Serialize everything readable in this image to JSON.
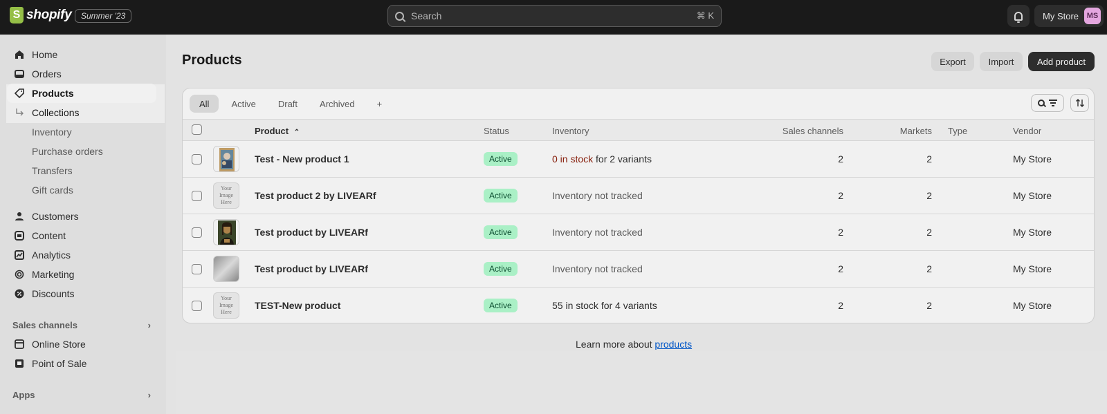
{
  "topbar": {
    "logo_text": "shopify",
    "edition": "Summer '23",
    "search_placeholder": "Search",
    "search_shortcut": "⌘ K",
    "store_name": "My Store",
    "avatar_initials": "MS"
  },
  "sidebar": {
    "items": [
      {
        "label": "Home",
        "icon": "home-icon"
      },
      {
        "label": "Orders",
        "icon": "inbox-icon"
      },
      {
        "label": "Products",
        "icon": "tag-icon"
      },
      {
        "label": "Collections",
        "icon": "sub-arrow-icon"
      },
      {
        "label": "Inventory"
      },
      {
        "label": "Purchase orders"
      },
      {
        "label": "Transfers"
      },
      {
        "label": "Gift cards"
      },
      {
        "label": "Customers",
        "icon": "person-icon"
      },
      {
        "label": "Content",
        "icon": "content-icon"
      },
      {
        "label": "Analytics",
        "icon": "chart-icon"
      },
      {
        "label": "Marketing",
        "icon": "target-icon"
      },
      {
        "label": "Discounts",
        "icon": "discount-icon"
      }
    ],
    "sales_channels_title": "Sales channels",
    "channels": [
      {
        "label": "Online Store",
        "icon": "store-icon"
      },
      {
        "label": "Point of Sale",
        "icon": "pos-icon"
      }
    ],
    "apps_title": "Apps"
  },
  "main": {
    "title": "Products",
    "export_label": "Export",
    "import_label": "Import",
    "add_label": "Add product",
    "tabs": [
      "All",
      "Active",
      "Draft",
      "Archived",
      "+"
    ],
    "columns": [
      "Product",
      "Status",
      "Inventory",
      "Sales channels",
      "Markets",
      "Type",
      "Vendor"
    ],
    "rows": [
      {
        "name": "Test - New product 1",
        "status": "Active",
        "inv_highlight": "0 in stock",
        "inv_rest": " for 2 variants",
        "channels": "2",
        "markets": "2",
        "type": "",
        "vendor": "My Store",
        "thumb": "painting"
      },
      {
        "name": "Test product 2 by LIVEARf",
        "status": "Active",
        "inv_highlight": "",
        "inv_rest": "Inventory not tracked",
        "channels": "2",
        "markets": "2",
        "type": "",
        "vendor": "My Store",
        "thumb": "placeholder"
      },
      {
        "name": "Test product by LIVEARf",
        "status": "Active",
        "inv_highlight": "",
        "inv_rest": "Inventory not tracked",
        "channels": "2",
        "markets": "2",
        "type": "",
        "vendor": "My Store",
        "thumb": "mona"
      },
      {
        "name": "Test product by LIVEARf",
        "status": "Active",
        "inv_highlight": "",
        "inv_rest": "Inventory not tracked",
        "channels": "2",
        "markets": "2",
        "type": "",
        "vendor": "My Store",
        "thumb": "gradient"
      },
      {
        "name": "TEST-New product",
        "status": "Active",
        "inv_highlight": "",
        "inv_rest": "55 in stock for 4 variants",
        "channels": "2",
        "markets": "2",
        "type": "",
        "vendor": "My Store",
        "thumb": "placeholder"
      }
    ],
    "placeholder_text": "Your Image Here",
    "learn_prefix": "Learn more about ",
    "learn_link": "products"
  }
}
